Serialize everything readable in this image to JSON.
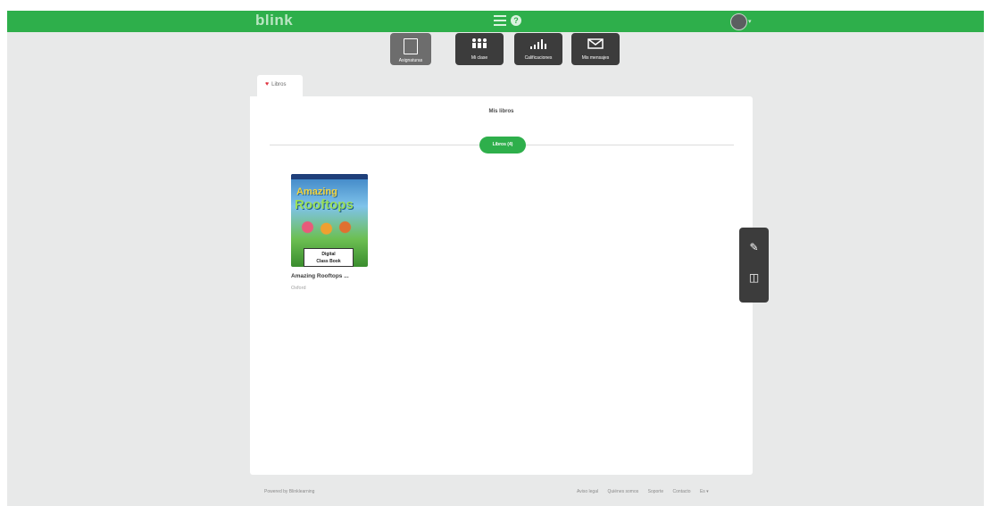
{
  "app": {
    "brand": "blink"
  },
  "header": {
    "menu_icon": "hamburger-icon",
    "help_icon": "help-icon",
    "help_glyph": "?",
    "avatar_caret": "▾"
  },
  "nav": [
    {
      "label": "Asignaturas",
      "icon": "screen-icon",
      "active": true
    },
    {
      "label": "Mi clase",
      "icon": "class-icon",
      "active": false
    },
    {
      "label": "Calificaciones",
      "icon": "grades-icon",
      "active": false
    },
    {
      "label": "Mis mensajes",
      "icon": "mail-icon",
      "active": false
    }
  ],
  "tab": {
    "heart": "♥",
    "label": "Libros"
  },
  "main": {
    "title": "Mis libros",
    "pill": "Libros (4)",
    "book": {
      "title": "Amazing Rooftops ...",
      "publisher": "Oxford",
      "cover_line1": "Amazing",
      "cover_line2": "Rooftops",
      "badge_line1": "Digital",
      "badge_line2": "Class Book"
    }
  },
  "toolbox": {
    "pencil": "✎",
    "book_tool": "◫"
  },
  "footer": {
    "left": "Powered by Blinklearning",
    "links": [
      "Aviso legal",
      "Quiénes somos",
      "Soporte",
      "Contacto",
      "Es ▾"
    ]
  },
  "colors": {
    "brand": "#2eaf4b",
    "dark_button": "#3c3c3c",
    "heart": "#e0333f"
  }
}
